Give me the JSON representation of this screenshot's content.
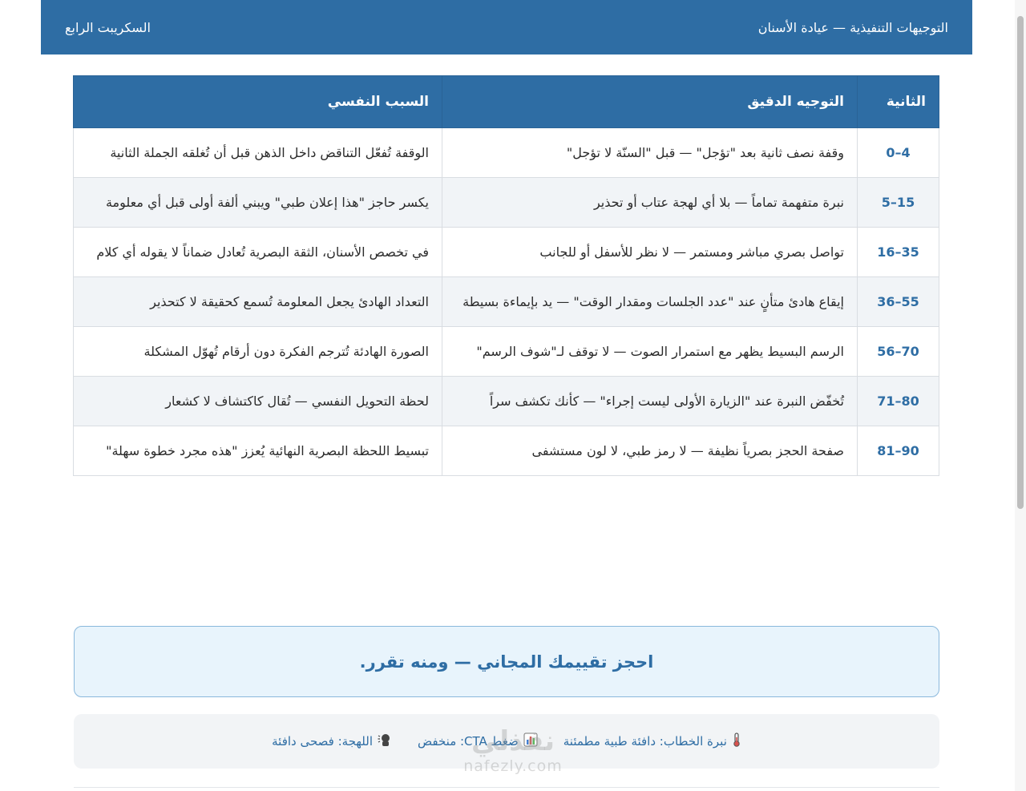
{
  "header": {
    "title": "التوجيهات التنفيذية — عيادة الأسنان",
    "script_label": "السكريبت الرابع"
  },
  "table": {
    "columns": [
      "الثانية",
      "التوجيه الدقيق",
      "السبب النفسي"
    ],
    "rows": [
      {
        "time": "0–4",
        "direction": "وقفة نصف ثانية بعد \"تؤجل\" — قبل \"السنّة لا تؤجل\"",
        "reason": "الوقفة تُفعّل التناقض داخل الذهن قبل أن تُغلقه الجملة الثانية"
      },
      {
        "time": "5–15",
        "direction": "نبرة متفهمة تماماً — بلا أي لهجة عتاب أو تحذير",
        "reason": "يكسر حاجز \"هذا إعلان طبي\" ويبني ألفة أولى قبل أي معلومة"
      },
      {
        "time": "16–35",
        "direction": "تواصل بصري مباشر ومستمر — لا نظر للأسفل أو للجانب",
        "reason": "في تخصص الأسنان، الثقة البصرية تُعادل ضماناً لا يقوله أي كلام"
      },
      {
        "time": "36–55",
        "direction": "إيقاع هادئ متأنٍ عند \"عدد الجلسات ومقدار الوقت\" — يد بإيماءة بسيطة",
        "reason": "التعداد الهادئ يجعل المعلومة تُسمع كحقيقة لا كتحذير"
      },
      {
        "time": "56–70",
        "direction": "الرسم البسيط يظهر مع استمرار الصوت — لا توقف لـ\"شوف الرسم\"",
        "reason": "الصورة الهادئة تُترجم الفكرة دون أرقام تُهوّل المشكلة"
      },
      {
        "time": "71–80",
        "direction": "تُخفّض النبرة عند \"الزيارة الأولى ليست إجراء\" — كأنك تكشف سراً",
        "reason": "لحظة التحويل النفسي — تُقال كاكتشاف لا كشعار"
      },
      {
        "time": "81–90",
        "direction": "صفحة الحجز بصرياً نظيفة — لا رمز طبي، لا لون مستشفى",
        "reason": "تبسيط اللحظة البصرية النهائية يُعزز \"هذه مجرد خطوة سهلة\""
      }
    ]
  },
  "cta": {
    "text": "احجز تقييمك المجاني — ومنه تقرر."
  },
  "meta": {
    "tone_icon": "thermometer-icon",
    "tone": "نبرة الخطاب: دافئة طبية مطمئنة",
    "cta_icon": "bar-chart-icon",
    "cta_pressure": "ضغط CTA: منخفض",
    "dialect_icon": "speaking-head-icon",
    "dialect": "اللهجة: فصحى دافئة"
  },
  "watermark": {
    "brand_ar": "نفذلي",
    "brand_en": "nafezly.com"
  },
  "colors": {
    "primary": "#2e6da4",
    "cta_bg": "#e8f4fc",
    "row_alt": "#f1f4f7"
  }
}
